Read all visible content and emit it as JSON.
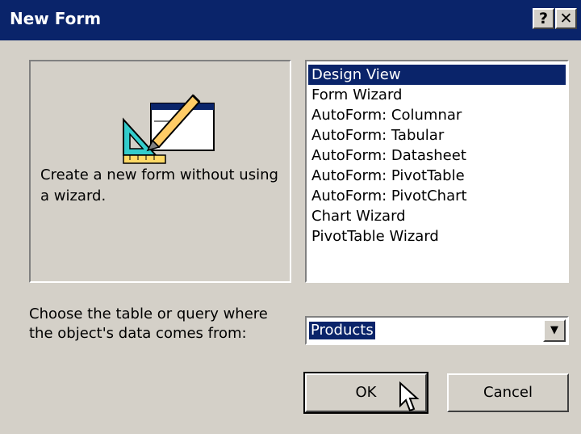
{
  "window": {
    "title": "New Form",
    "help_glyph": "?",
    "close_glyph": "✕"
  },
  "preview": {
    "description": "Create a new form without using a wizard.",
    "icon": "form-design-icon"
  },
  "list": {
    "items": [
      "Design View",
      "Form Wizard",
      "AutoForm: Columnar",
      "AutoForm: Tabular",
      "AutoForm: Datasheet",
      "AutoForm: PivotTable",
      "AutoForm: PivotChart",
      "Chart Wizard",
      "PivotTable Wizard"
    ],
    "selected": "Design View"
  },
  "source": {
    "label": "Choose the table or query where the object's data comes from:",
    "value": "Products",
    "arrow_glyph": "▼"
  },
  "buttons": {
    "ok": "OK",
    "cancel": "Cancel"
  },
  "colors": {
    "titlebar": "#0a246a",
    "face": "#d4d0c8",
    "selection": "#0a246a"
  }
}
